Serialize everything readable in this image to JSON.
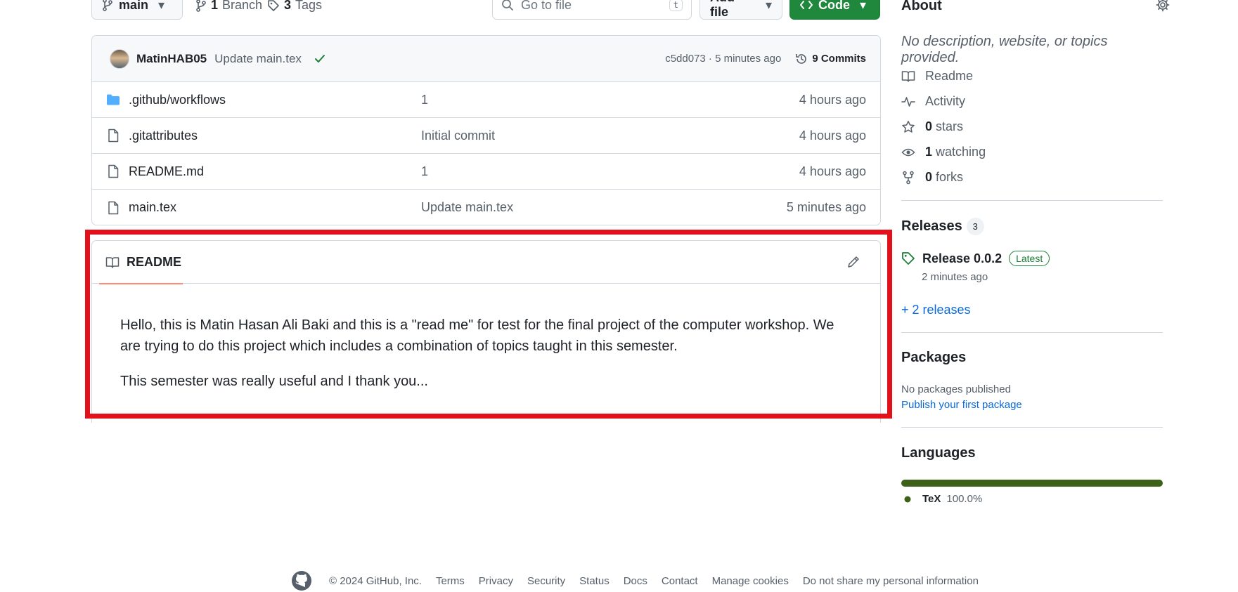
{
  "toolbar": {
    "branch": "main",
    "branch_count": "1",
    "branch_label": "Branch",
    "tag_count": "3",
    "tag_label": "Tags",
    "search_placeholder": "Go to file",
    "search_shortcut": "t",
    "add_file_label": "Add file",
    "code_label": "Code"
  },
  "commit": {
    "author": "MatinHAB05",
    "message": "Update main.tex",
    "hash_time": "c5dd073 · 5 minutes ago",
    "commits_label": "9 Commits"
  },
  "files": [
    {
      "type": "folder",
      "name": ".github/workflows",
      "message": "1",
      "time": "4 hours ago"
    },
    {
      "type": "file",
      "name": ".gitattributes",
      "message": "Initial commit",
      "time": "4 hours ago"
    },
    {
      "type": "file",
      "name": "README.md",
      "message": "1",
      "time": "4 hours ago"
    },
    {
      "type": "file",
      "name": "main.tex",
      "message": "Update main.tex",
      "time": "5 minutes ago"
    }
  ],
  "readme": {
    "tab_label": "README",
    "paragraphs": [
      "Hello, this is Matin Hasan Ali Baki and this is a \"read me\" for test for the final project of the computer workshop. We are trying to do this project which includes a combination of topics taught in this semester.",
      "This semester was really useful and I thank you..."
    ]
  },
  "about": {
    "title": "About",
    "description": "No description, website, or topics provided.",
    "readme_label": "Readme",
    "activity_label": "Activity",
    "stars_count": "0",
    "stars_label": "stars",
    "watching_count": "1",
    "watching_label": "watching",
    "forks_count": "0",
    "forks_label": "forks"
  },
  "releases": {
    "title": "Releases",
    "count": "3",
    "latest_name": "Release 0.0.2",
    "latest_badge": "Latest",
    "latest_time": "2 minutes ago",
    "more_link": "+ 2 releases"
  },
  "packages": {
    "title": "Packages",
    "empty_text": "No packages published",
    "publish_link": "Publish your first package"
  },
  "languages": {
    "title": "Languages",
    "items": [
      {
        "name": "TeX",
        "percent_label": "100.0%",
        "percent": 100.0,
        "color": "#3d6117"
      }
    ]
  },
  "footer": {
    "copyright": "© 2024 GitHub, Inc.",
    "links": [
      "Terms",
      "Privacy",
      "Security",
      "Status",
      "Docs",
      "Contact",
      "Manage cookies",
      "Do not share my personal information"
    ]
  },
  "colors": {
    "accent_green": "#1f883d",
    "link_blue": "#0969da",
    "highlight_red": "#e3111c",
    "tab_underline": "#fd8c73"
  }
}
